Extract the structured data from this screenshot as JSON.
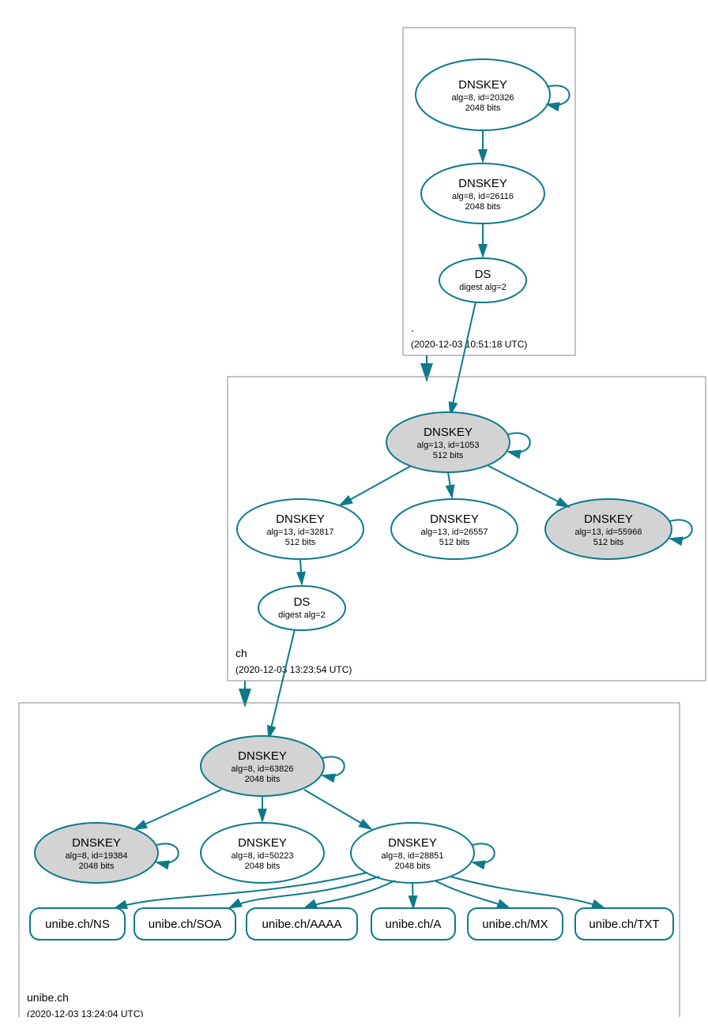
{
  "colors": {
    "stroke": "#0d7a8a",
    "grey_fill": "#d3d3d3"
  },
  "zones": {
    "root": {
      "label": ".",
      "timestamp": "(2020-12-03 10:51:18 UTC)"
    },
    "ch": {
      "label": "ch",
      "timestamp": "(2020-12-03 13:23:54 UTC)"
    },
    "unibe": {
      "label": "unibe.ch",
      "timestamp": "(2020-12-03 13:24:04 UTC)"
    }
  },
  "nodes": {
    "root_ksk": {
      "title": "DNSKEY",
      "sub1": "alg=8, id=20326",
      "sub2": "2048 bits"
    },
    "root_zsk": {
      "title": "DNSKEY",
      "sub1": "alg=8, id=26116",
      "sub2": "2048 bits"
    },
    "root_ds": {
      "title": "DS",
      "sub1": "digest alg=2"
    },
    "ch_ksk": {
      "title": "DNSKEY",
      "sub1": "alg=13, id=1053",
      "sub2": "512 bits"
    },
    "ch_z1": {
      "title": "DNSKEY",
      "sub1": "alg=13, id=32817",
      "sub2": "512 bits"
    },
    "ch_z2": {
      "title": "DNSKEY",
      "sub1": "alg=13, id=26557",
      "sub2": "512 bits"
    },
    "ch_z3": {
      "title": "DNSKEY",
      "sub1": "alg=13, id=55966",
      "sub2": "512 bits"
    },
    "ch_ds": {
      "title": "DS",
      "sub1": "digest alg=2"
    },
    "u_ksk": {
      "title": "DNSKEY",
      "sub1": "alg=8, id=63826",
      "sub2": "2048 bits"
    },
    "u_z1": {
      "title": "DNSKEY",
      "sub1": "alg=8, id=19384",
      "sub2": "2048 bits"
    },
    "u_z2": {
      "title": "DNSKEY",
      "sub1": "alg=8, id=50223",
      "sub2": "2048 bits"
    },
    "u_z3": {
      "title": "DNSKEY",
      "sub1": "alg=8, id=28851",
      "sub2": "2048 bits"
    },
    "rr_ns": {
      "label": "unibe.ch/NS"
    },
    "rr_soa": {
      "label": "unibe.ch/SOA"
    },
    "rr_aaaa": {
      "label": "unibe.ch/AAAA"
    },
    "rr_a": {
      "label": "unibe.ch/A"
    },
    "rr_mx": {
      "label": "unibe.ch/MX"
    },
    "rr_txt": {
      "label": "unibe.ch/TXT"
    }
  }
}
